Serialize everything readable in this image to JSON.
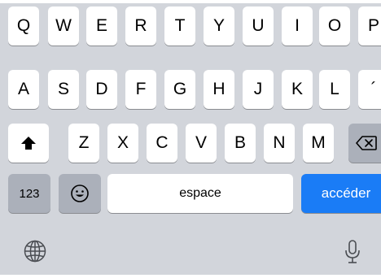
{
  "keyboard": {
    "row1": [
      "Q",
      "W",
      "E",
      "R",
      "T",
      "Y",
      "U",
      "I",
      "O",
      "P"
    ],
    "row2": [
      "A",
      "S",
      "D",
      "F",
      "G",
      "H",
      "J",
      "K",
      "L",
      "´"
    ],
    "row3": [
      "Z",
      "X",
      "C",
      "V",
      "B",
      "N",
      "M"
    ],
    "numbers_label": "123",
    "space_label": "espace",
    "return_label": "accéder",
    "icons": {
      "shift": "shift-arrow-icon",
      "delete": "backspace-icon",
      "emoji": "emoji-face-icon",
      "globe": "globe-icon",
      "mic": "microphone-icon"
    },
    "colors": {
      "background": "#d2d5db",
      "key": "#ffffff",
      "function_key": "#abb0ba",
      "accent": "#1a7cf6"
    }
  }
}
